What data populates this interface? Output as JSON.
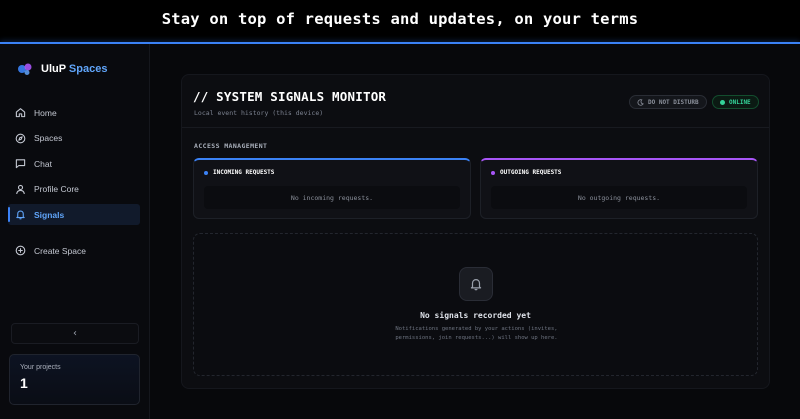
{
  "banner": {
    "text": "Stay on top of requests and updates, on your terms"
  },
  "brand": {
    "name": "UluP",
    "accent": "Spaces"
  },
  "nav": {
    "items": [
      {
        "label": "Home",
        "icon": "home-icon"
      },
      {
        "label": "Spaces",
        "icon": "compass-icon"
      },
      {
        "label": "Chat",
        "icon": "chat-icon"
      },
      {
        "label": "Profile Core",
        "icon": "user-icon"
      },
      {
        "label": "Signals",
        "icon": "bell-icon",
        "active": true
      }
    ],
    "create": {
      "label": "Create Space",
      "icon": "plus-circle-icon"
    }
  },
  "sidebar": {
    "collapse_glyph": "‹"
  },
  "projects": {
    "label": "Your projects",
    "count": "1"
  },
  "main": {
    "title": "// SYSTEM SIGNALS MONITOR",
    "subtitle": "Local event history (this device)",
    "status": {
      "dnd": "DO NOT DISTURB",
      "online": "ONLINE"
    },
    "access_label": "ACCESS MANAGEMENT",
    "incoming": {
      "title": "INCOMING REQUESTS",
      "empty": "No incoming requests."
    },
    "outgoing": {
      "title": "OUTGOING REQUESTS",
      "empty": "No outgoing requests."
    },
    "signals": {
      "empty_title": "No signals recorded yet",
      "empty_desc": "Notifications generated by your actions (invites, permissions, join requests...) will show up here."
    }
  },
  "colors": {
    "accent": "#3b82f6",
    "online": "#34d399",
    "outgoing_accent": "#a855f7",
    "background": "#07080b"
  }
}
